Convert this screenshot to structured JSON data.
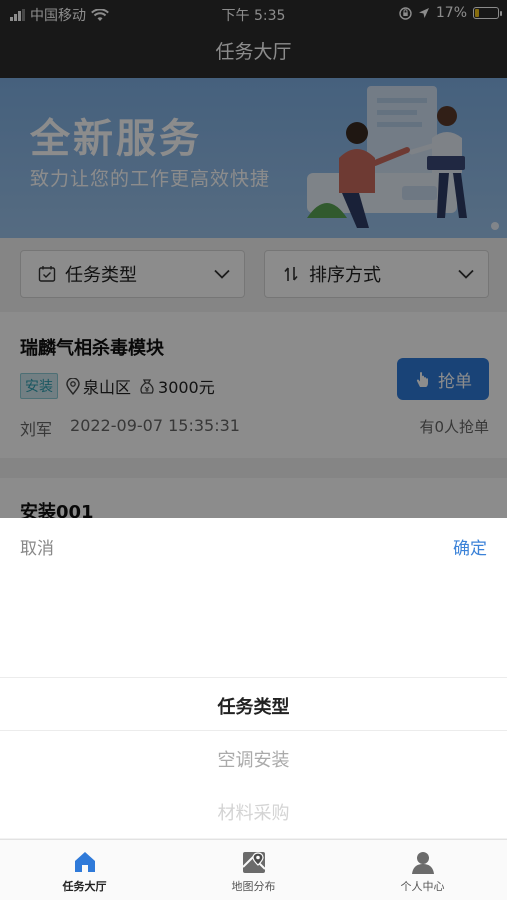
{
  "status_bar": {
    "carrier": "中国移动",
    "time": "下午 5:35",
    "battery_pct": "17%",
    "battery_level": 0.17
  },
  "nav": {
    "title": "任务大厅"
  },
  "banner": {
    "title": "全新服务",
    "subtitle": "致力让您的工作更高效快捷"
  },
  "filters": {
    "task_type_label": "任务类型",
    "sort_label": "排序方式"
  },
  "tasks": [
    {
      "title": "瑞麟气相杀毒模块",
      "tag": "安装",
      "location": "泉山区",
      "price": "3000元",
      "grab_label": "抢单",
      "owner": "刘军",
      "time": "2022-09-07 15:35:31",
      "grab_count": "有0人抢单"
    },
    {
      "title": "安装001"
    }
  ],
  "picker": {
    "cancel_label": "取消",
    "confirm_label": "确定",
    "options": [
      "任务类型",
      "空调安装",
      "材料采购"
    ]
  },
  "tabbar": {
    "items": [
      {
        "label": "任务大厅",
        "icon": "home-icon"
      },
      {
        "label": "地图分布",
        "icon": "map-icon"
      },
      {
        "label": "个人中心",
        "icon": "user-icon"
      }
    ]
  },
  "colors": {
    "accent": "#2f7ad9",
    "confirm": "#3b82d8",
    "header_bg": "#2d2d2d",
    "tag_text": "#2f9eb1",
    "tab_active_icon": "#2f7ad9"
  }
}
